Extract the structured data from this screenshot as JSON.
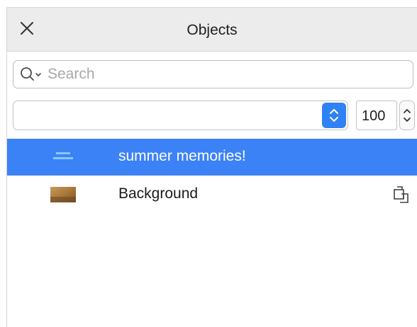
{
  "header": {
    "title": "Objects",
    "close_icon": "close-icon"
  },
  "search": {
    "placeholder": "Search",
    "value": "",
    "icon": "search-icon"
  },
  "controls": {
    "merge_mode_value": "",
    "opacity_value": "100"
  },
  "objects": [
    {
      "label": "summer memories!",
      "selected": true,
      "thumbnail": "text-layer-thumbnail"
    },
    {
      "label": "Background",
      "selected": false,
      "thumbnail": "image-layer-thumbnail",
      "status_icon": "lock-icon"
    }
  ],
  "colors": {
    "selection": "#3c82f7",
    "accent": "#2f82f6",
    "header_bg": "#ececec"
  }
}
